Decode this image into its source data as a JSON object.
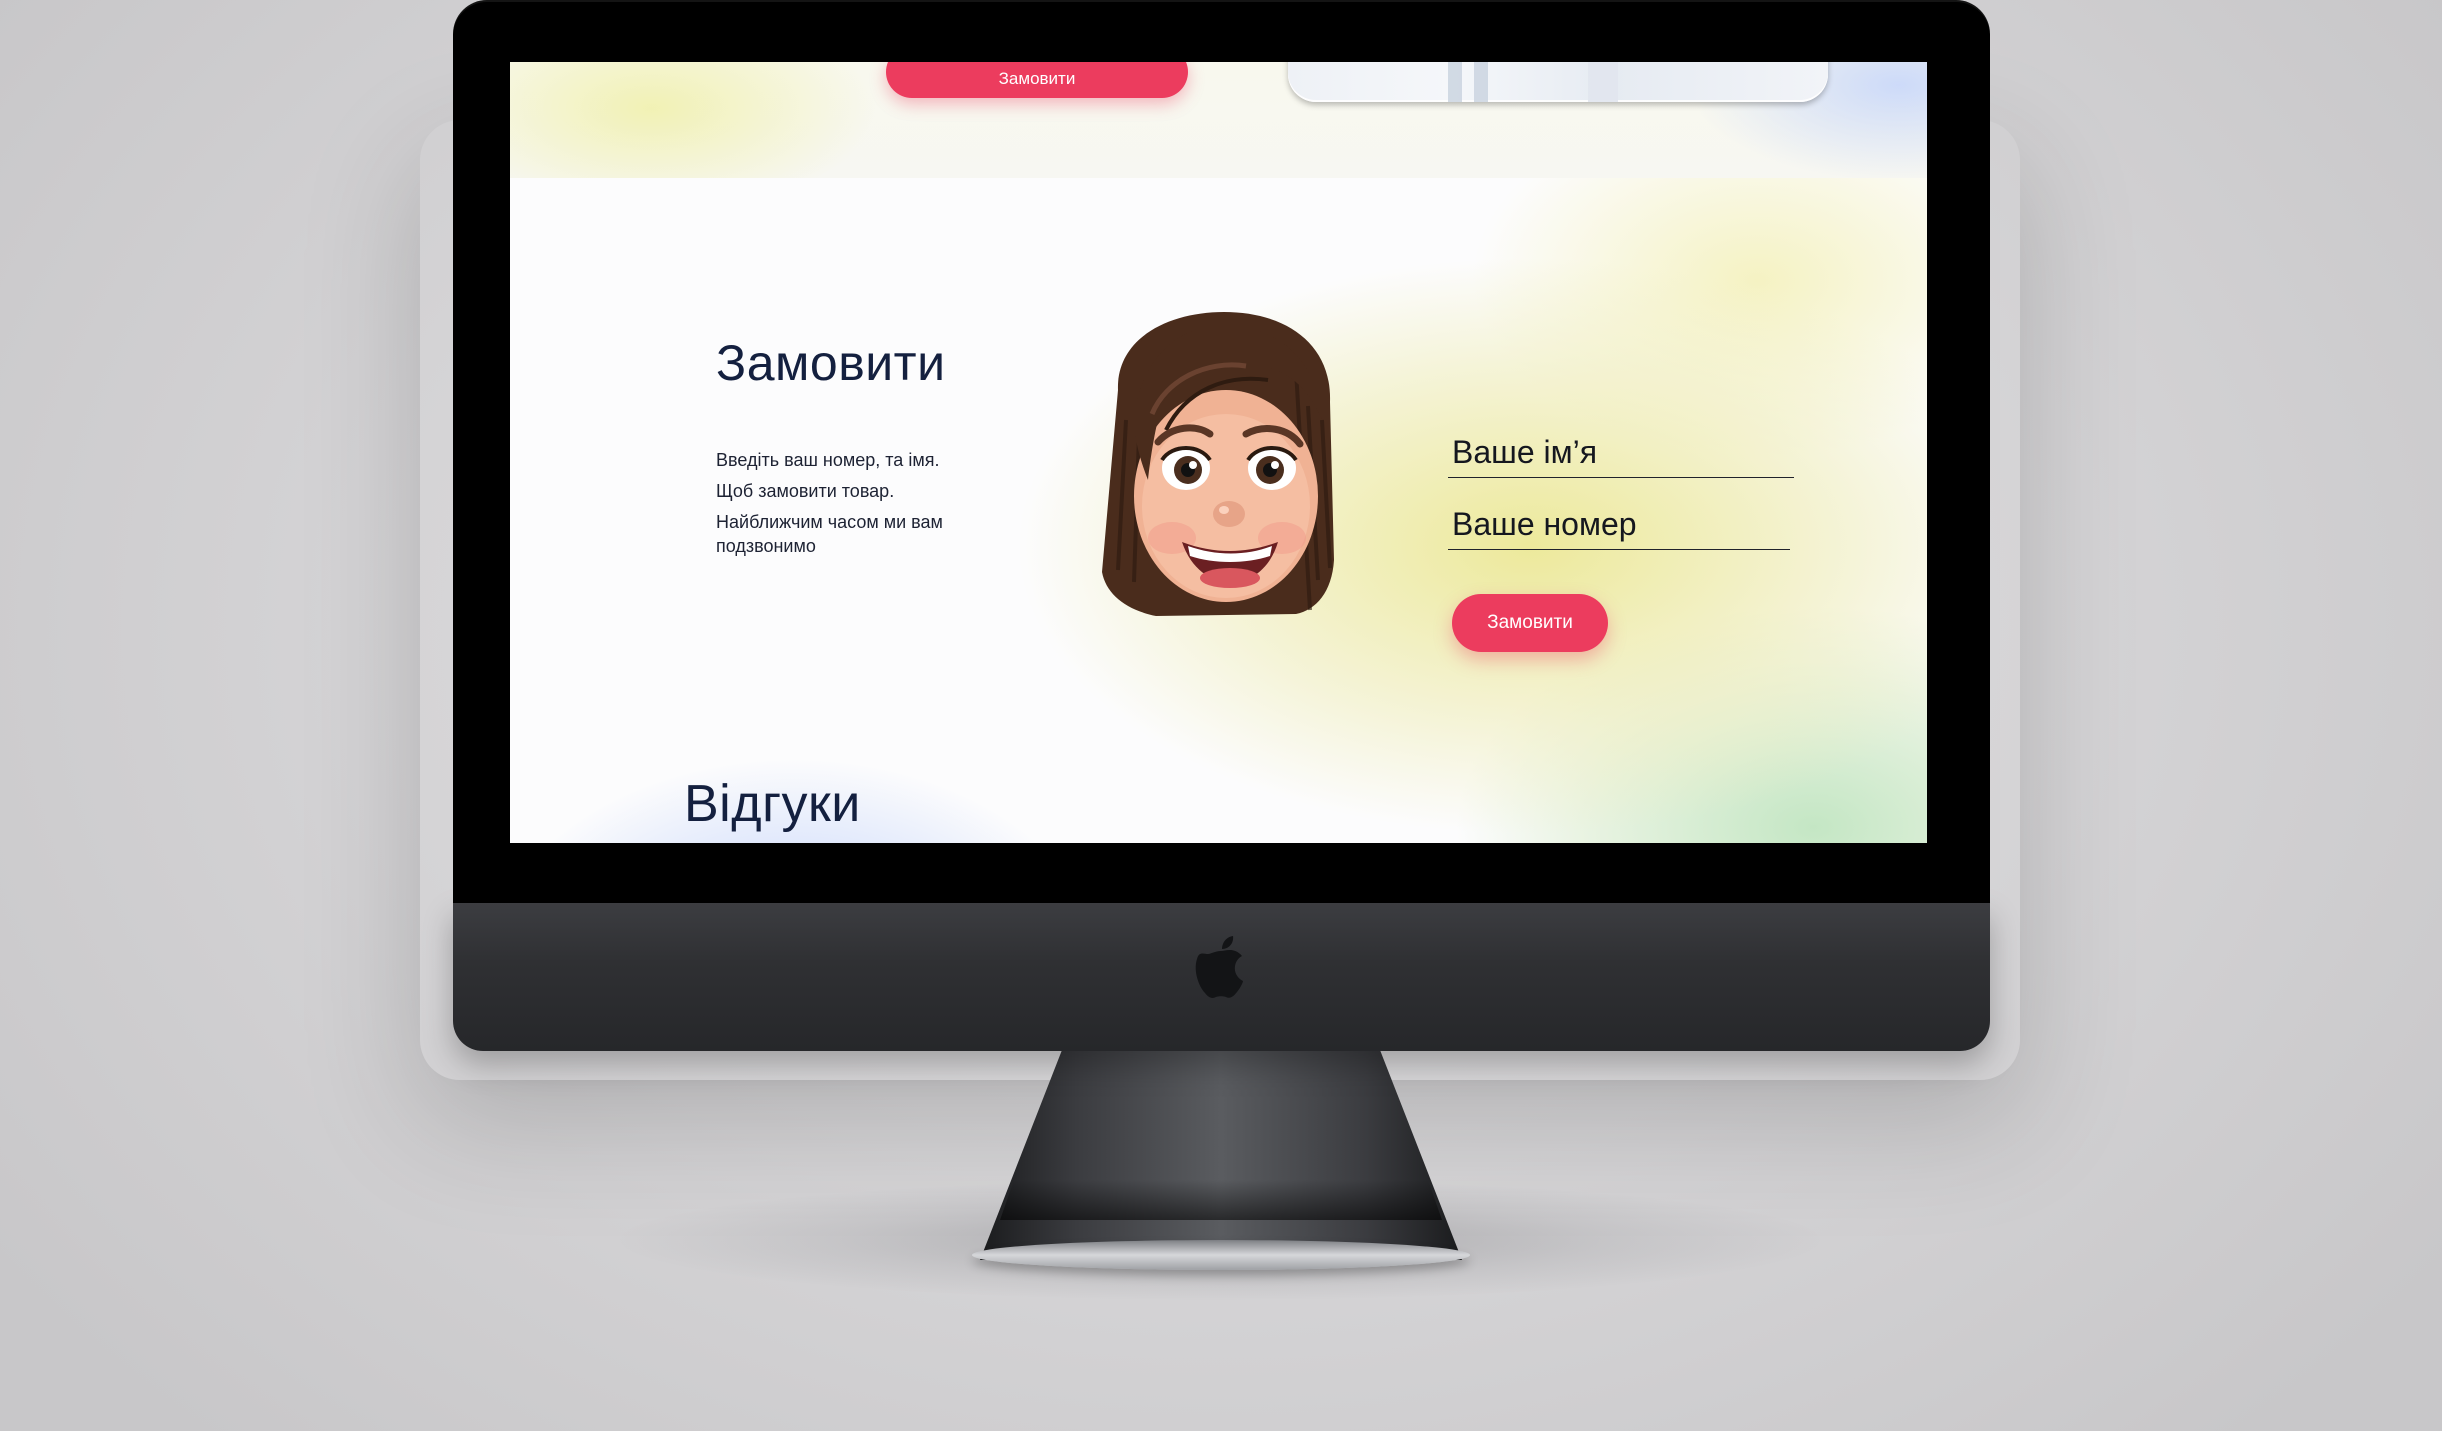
{
  "header": {
    "top_button_label": "Замовити"
  },
  "order_section": {
    "title": "Замовити",
    "description_lines": [
      "Введіть ваш номер, та імя.",
      "Щоб замовити товар.",
      "Найближчим часом ми вам подзвонимо"
    ],
    "avatar": "memoji-avatar",
    "name_placeholder": "Ваше ім’я",
    "phone_placeholder": "Ваше номер",
    "submit_label": "Замовити"
  },
  "reviews_section": {
    "title": "Відгуки"
  },
  "colors": {
    "accent": "#ec3c5e",
    "heading": "#14203f",
    "bezel": "#000000",
    "chin": "#2f3033"
  },
  "icons": {
    "chin_logo": "apple-logo-icon"
  }
}
